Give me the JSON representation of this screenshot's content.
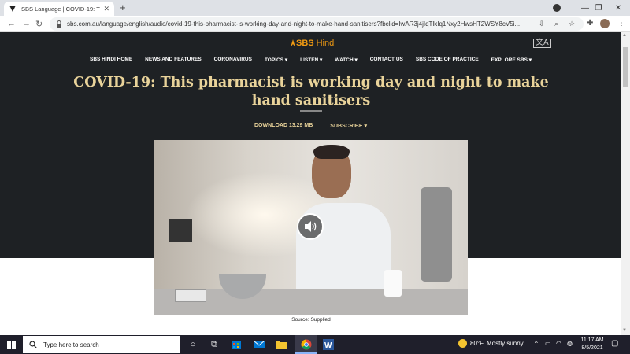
{
  "browser": {
    "tab_title": "SBS Language | COVID-19: This p",
    "url": "sbs.com.au/language/english/audio/covid-19-this-pharmacist-is-working-day-and-night-to-make-hand-sanitisers?fbclid=IwAR3j4jIqTlkIq1Nxy2HwsHT2WSY8cV5i..."
  },
  "site": {
    "logo_main": "SBS",
    "logo_sub": "Hindi",
    "lang_icon": "language-icon"
  },
  "nav": {
    "items": [
      "SBS HINDI HOME",
      "NEWS AND FEATURES",
      "CORONAVIRUS",
      "TOPICS ▾",
      "LISTEN ▾",
      "WATCH ▾",
      "CONTACT US",
      "SBS CODE OF PRACTICE",
      "EXPLORE SBS ▾"
    ]
  },
  "article": {
    "headline": "COVID-19: This pharmacist is working day and night to make hand sanitisers",
    "download": "DOWNLOAD 13.29 MB",
    "subscribe": "SUBSCRIBE ▾",
    "caption": "Source: Supplied"
  },
  "taskbar": {
    "search_placeholder": "Type here to search",
    "weather_temp": "80°F",
    "weather_text": "Mostly sunny",
    "time": "11:17 AM",
    "date": "8/5/2021"
  },
  "colors": {
    "page_bg": "#1e2124",
    "headline": "#e9d39a",
    "logo": "#f39c12"
  }
}
